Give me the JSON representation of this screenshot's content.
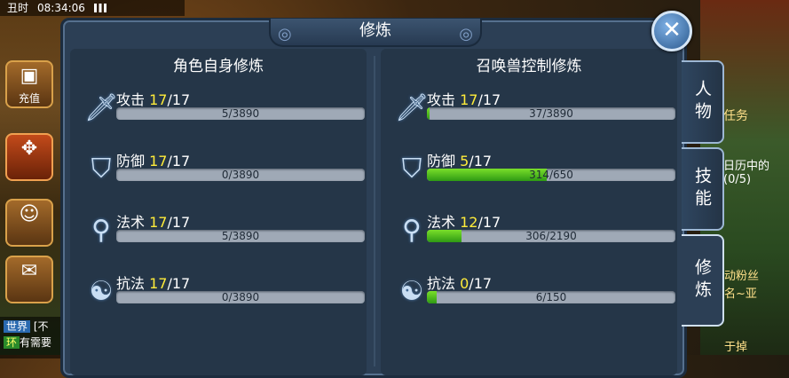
{
  "status_bar": {
    "time_period": "丑时",
    "clock": "08:34:06"
  },
  "left_hud": {
    "recharge_label": "充值"
  },
  "chat": {
    "channel": "世界",
    "channel2": "环",
    "line1": "[不",
    "line2": "有需要"
  },
  "right_hud": {
    "task_label": "任务",
    "daily_label": "日历中的",
    "daily_count": "(0/5)",
    "scroll1": "动粉丝",
    "scroll2": "名~亚",
    "scroll3": "于掉"
  },
  "panel": {
    "title": "修炼",
    "close_symbol": "✕",
    "left_column": {
      "header": "角色自身修炼",
      "rows": [
        {
          "icon": "sword-icon",
          "name": "攻击",
          "level": "17",
          "max": "/17",
          "progress_text": "5/3890",
          "progress": 0.0013
        },
        {
          "icon": "shield-icon",
          "name": "防御",
          "level": "17",
          "max": "/17",
          "progress_text": "0/3890",
          "progress": 0
        },
        {
          "icon": "magic-staff-icon",
          "name": "法术",
          "level": "17",
          "max": "/17",
          "progress_text": "5/3890",
          "progress": 0.0013
        },
        {
          "icon": "yin-yang-icon",
          "name": "抗法",
          "level": "17",
          "max": "/17",
          "progress_text": "0/3890",
          "progress": 0
        }
      ]
    },
    "right_column": {
      "header": "召唤兽控制修炼",
      "rows": [
        {
          "icon": "sword-icon",
          "name": "攻击",
          "level": "17",
          "max": "/17",
          "progress_text": "37/3890",
          "progress": 0.0095
        },
        {
          "icon": "shield-icon",
          "name": "防御",
          "level": "5",
          "max": "/17",
          "progress_text": "314/650",
          "progress": 0.483
        },
        {
          "icon": "magic-staff-icon",
          "name": "法术",
          "level": "12",
          "max": "/17",
          "progress_text": "306/2190",
          "progress": 0.14
        },
        {
          "icon": "yin-yang-icon",
          "name": "抗法",
          "level": "0",
          "max": "/17",
          "progress_text": "6/150",
          "progress": 0.04
        }
      ]
    }
  },
  "side_tabs": [
    {
      "label": "人物",
      "active": false
    },
    {
      "label": "技能",
      "active": false
    },
    {
      "label": "修炼",
      "active": true
    }
  ],
  "colors": {
    "level_highlight": "#ffec3a",
    "progress_fill": "#5cc21e",
    "panel_bg": "#2c3f55"
  }
}
